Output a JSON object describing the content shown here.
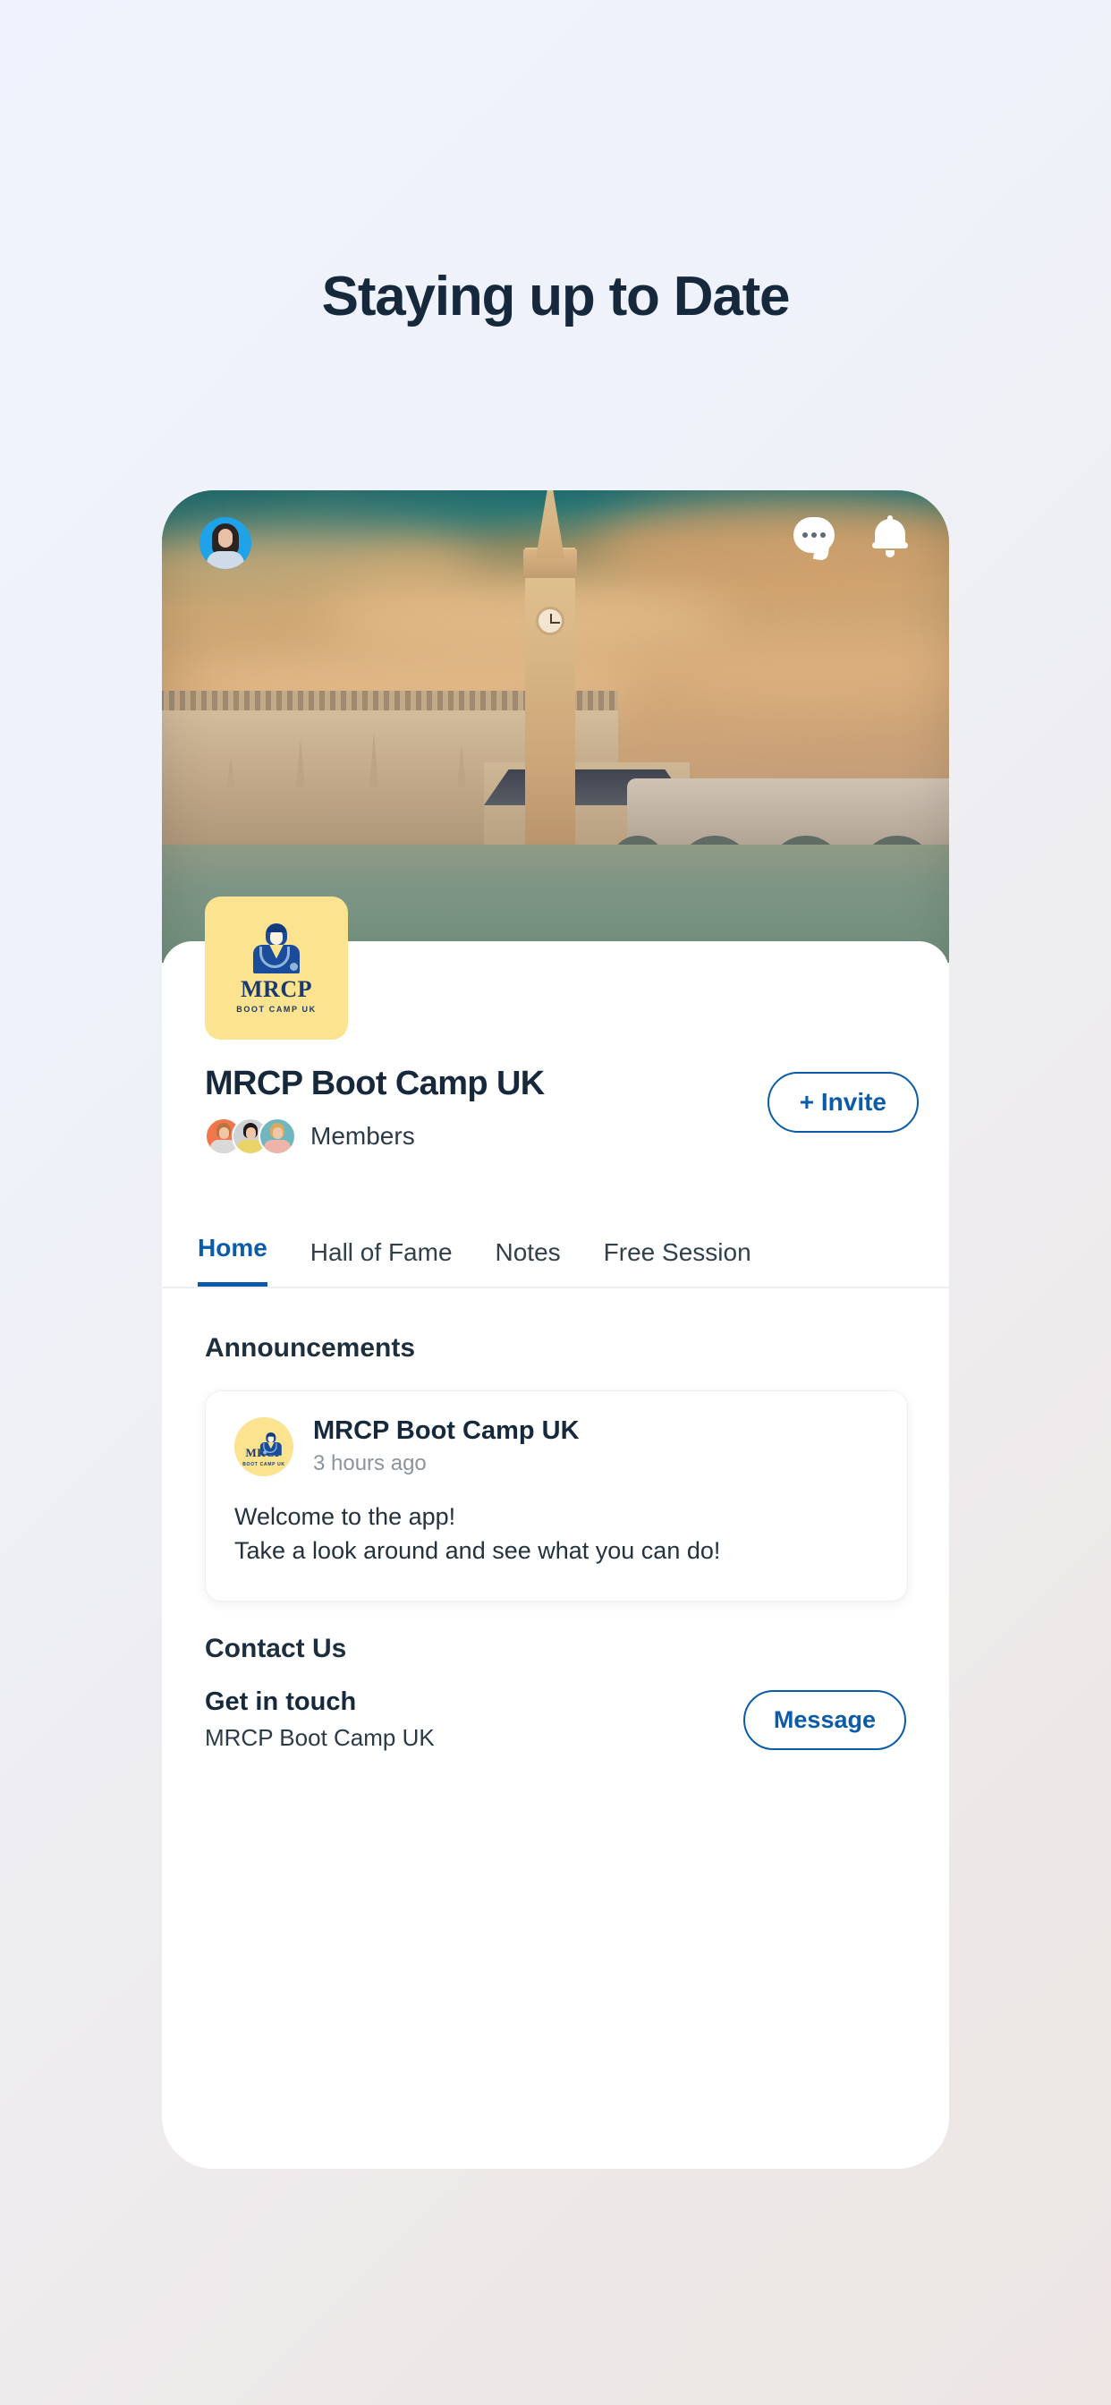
{
  "page": {
    "title": "Staying up to Date"
  },
  "app": {
    "header": {
      "avatar_icon": "user-avatar",
      "chat_icon": "chat-bubble-icon",
      "notifications_icon": "bell-icon"
    },
    "hero_image": "westminster-big-ben-photo",
    "org": {
      "logo_mrcp": "MRCP",
      "logo_sub": "BOOT CAMP UK",
      "name": "MRCP Boot Camp UK",
      "members_label": "Members",
      "invite_label": "+ Invite"
    },
    "tabs": [
      {
        "label": "Home",
        "active": true
      },
      {
        "label": "Hall of Fame",
        "active": false
      },
      {
        "label": "Notes",
        "active": false
      },
      {
        "label": "Free Session",
        "active": false
      }
    ],
    "announcements": {
      "section_title": "Announcements",
      "items": [
        {
          "author": "MRCP Boot Camp UK",
          "time": "3 hours ago",
          "body": "Welcome to the app!\nTake a look around and see what you can do!"
        }
      ]
    },
    "contact": {
      "section_title": "Contact Us",
      "title": "Get in touch",
      "subtitle": "MRCP Boot Camp UK",
      "button_label": "Message"
    }
  },
  "colors": {
    "accent_blue": "#0B5BA8",
    "heading_navy": "#16293C",
    "logo_yellow": "#FBE38F",
    "muted_gray": "#8B949C"
  }
}
